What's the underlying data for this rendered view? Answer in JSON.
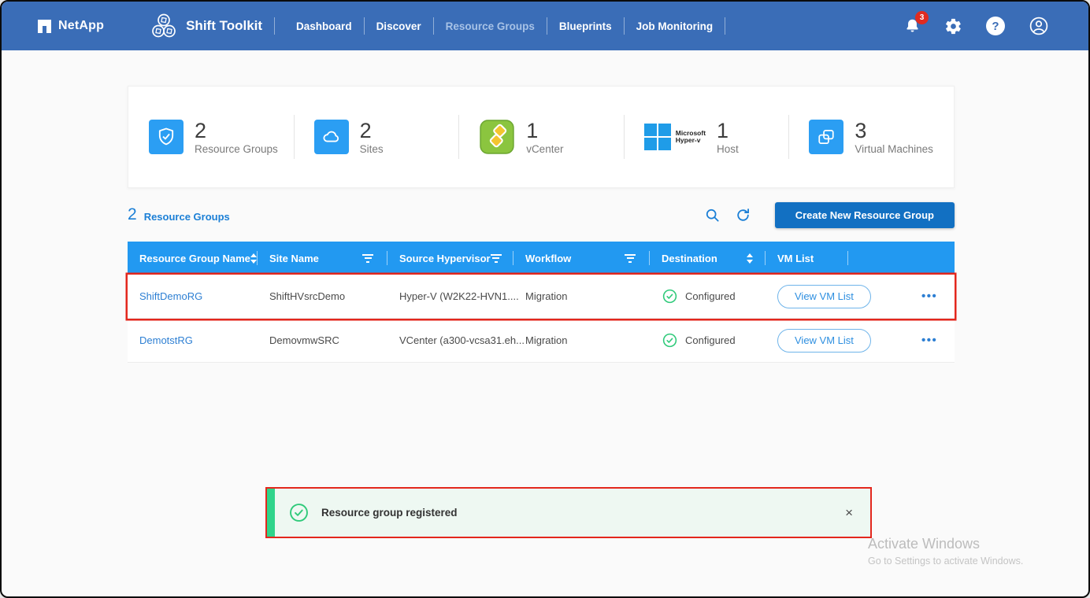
{
  "colors": {
    "navbar_bg": "#3a6db7",
    "table_header_bg": "#2299f1",
    "accent_blue": "#1b7fd6",
    "primary_button_bg": "#1270c2",
    "link_blue": "#2d7fd3",
    "success_green": "#2fca7a",
    "annotation_red": "#e3271d",
    "toast_bg": "#eef8f2",
    "toast_bar_green": "#2fd48b",
    "badge_red": "#e02b20"
  },
  "navbar": {
    "brand": "NetApp",
    "app_title": "Shift Toolkit",
    "items": [
      {
        "label": "Dashboard"
      },
      {
        "label": "Discover"
      },
      {
        "label": "Resource Groups"
      },
      {
        "label": "Blueprints"
      },
      {
        "label": "Job Monitoring"
      }
    ],
    "notification_badge": "3"
  },
  "stats": [
    {
      "icon": "shield-check-icon",
      "value": "2",
      "label": "Resource Groups"
    },
    {
      "icon": "cloud-icon",
      "value": "2",
      "label": "Sites"
    },
    {
      "icon": "vcenter-icon",
      "value": "1",
      "label": "vCenter"
    },
    {
      "icon": "hyperv-icon",
      "value": "1",
      "label": "Host",
      "icon_caption_line1": "Microsoft",
      "icon_caption_line2": "Hyper-v"
    },
    {
      "icon": "vm-icon",
      "value": "3",
      "label": "Virtual Machines"
    }
  ],
  "list_section": {
    "count": "2",
    "title": "Resource Groups",
    "create_button_label": "Create New Resource Group"
  },
  "table": {
    "columns": [
      {
        "label": "Resource Group Name"
      },
      {
        "label": "Site Name"
      },
      {
        "label": "Source Hypervisor"
      },
      {
        "label": "Workflow"
      },
      {
        "label": "Destination"
      },
      {
        "label": "VM List"
      },
      {
        "label": ""
      }
    ],
    "rows": [
      {
        "name": "ShiftDemoRG",
        "site_name": "ShiftHVsrcDemo",
        "source_hypervisor": "Hyper-V (W2K22-HVN1....",
        "workflow": "Migration",
        "destination_status": "Configured",
        "vm_list_label": "View VM List"
      },
      {
        "name": "DemotstRG",
        "site_name": "DemovmwSRC",
        "source_hypervisor": "VCenter (a300-vcsa31.eh...",
        "workflow": "Migration",
        "destination_status": "Configured",
        "vm_list_label": "View VM List"
      }
    ]
  },
  "toast": {
    "message": "Resource group registered"
  },
  "watermark": {
    "line1": "Activate Windows",
    "line2": "Go to Settings to activate Windows."
  },
  "icons": {
    "more_options": "•••",
    "close": "×",
    "help": "?"
  }
}
